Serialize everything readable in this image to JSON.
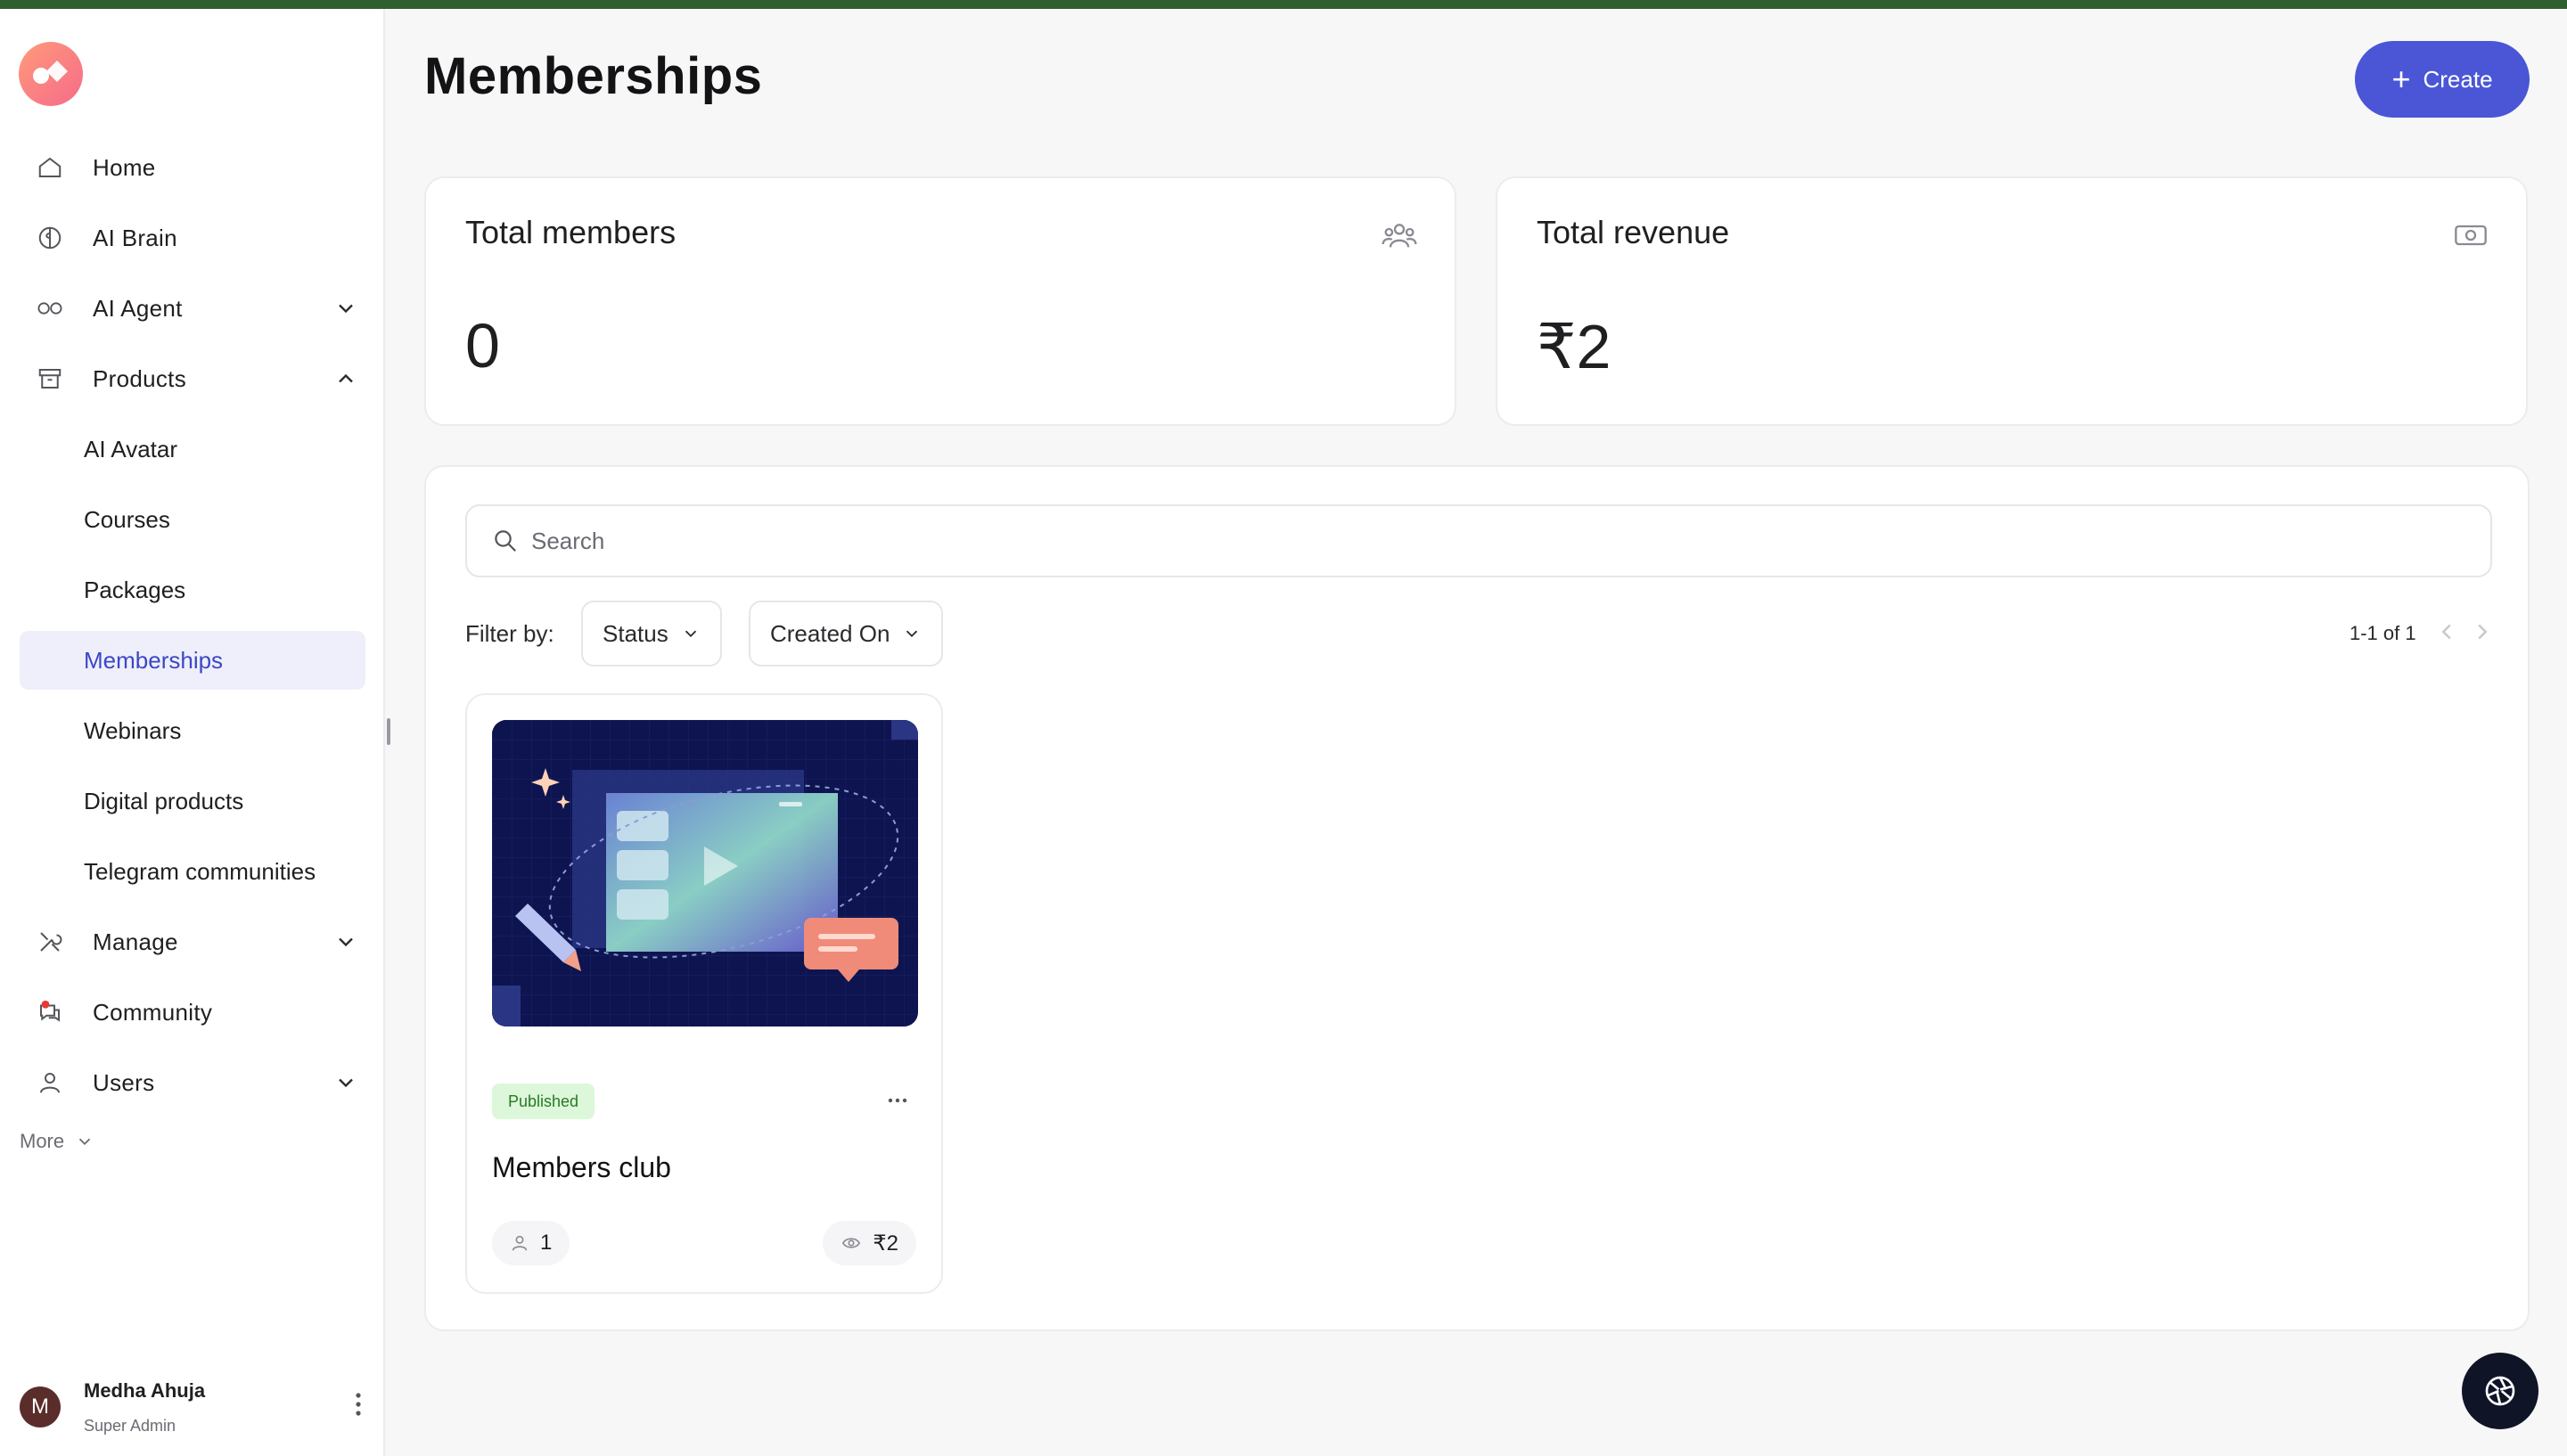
{
  "sidebar": {
    "items": [
      {
        "label": "Home"
      },
      {
        "label": "AI Brain"
      },
      {
        "label": "AI Agent"
      },
      {
        "label": "Products"
      }
    ],
    "products_sub": [
      {
        "label": "AI Avatar"
      },
      {
        "label": "Courses"
      },
      {
        "label": "Packages"
      },
      {
        "label": "Memberships"
      },
      {
        "label": "Webinars"
      },
      {
        "label": "Digital products"
      },
      {
        "label": "Telegram communities"
      }
    ],
    "items_after": [
      {
        "label": "Manage"
      },
      {
        "label": "Community"
      },
      {
        "label": "Users"
      }
    ],
    "more_label": "More",
    "user": {
      "initial": "M",
      "name": "Medha Ahuja",
      "role": "Super Admin"
    }
  },
  "header": {
    "title": "Memberships",
    "create_label": "Create"
  },
  "stats": {
    "members": {
      "title": "Total members",
      "value": "0"
    },
    "revenue": {
      "title": "Total revenue",
      "value": "₹2"
    }
  },
  "list": {
    "search_placeholder": "Search",
    "filter_label": "Filter by:",
    "filters": {
      "status": "Status",
      "created_on": "Created On"
    },
    "pagination": "1-1 of 1",
    "cards": [
      {
        "status": "Published",
        "title": "Members club",
        "members": "1",
        "price": "₹2"
      }
    ]
  },
  "colors": {
    "accent": "#4a56d6",
    "active_bg": "#eeeffb",
    "published_bg": "#dcf7d9",
    "published_text": "#287a25"
  }
}
